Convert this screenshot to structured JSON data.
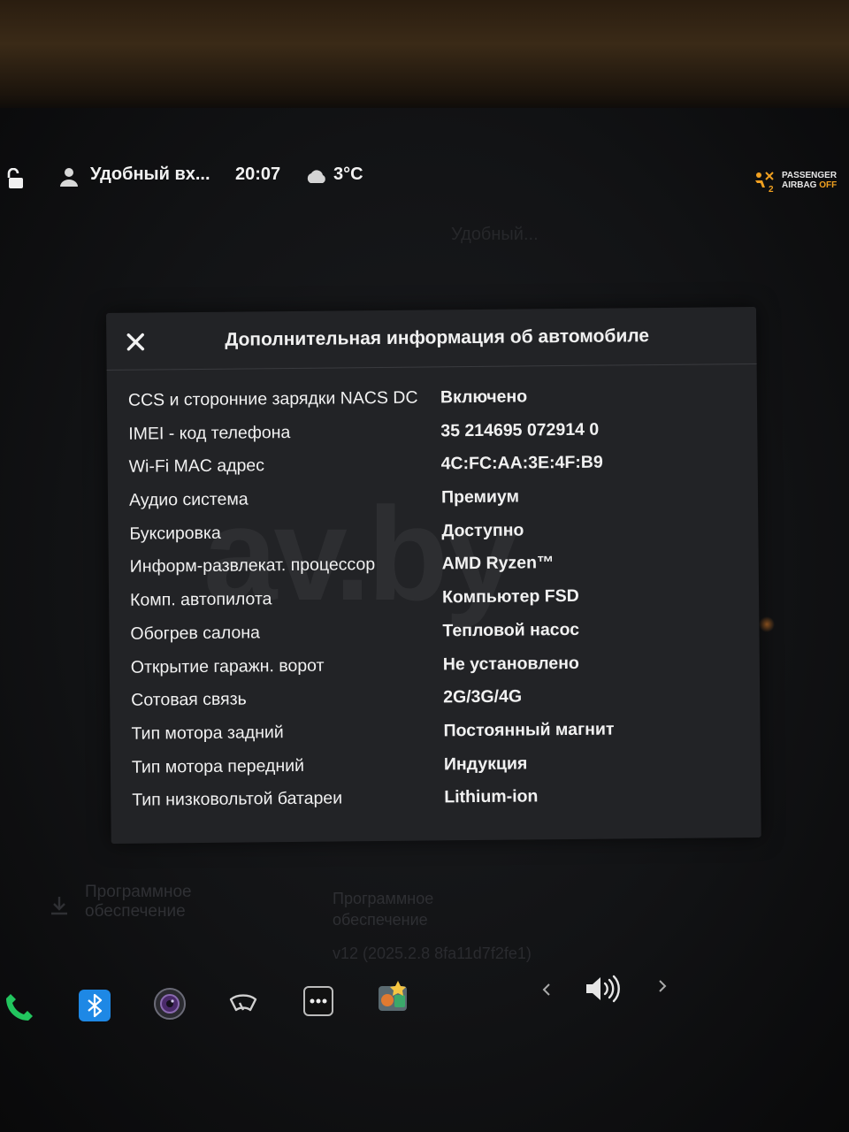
{
  "status_bar": {
    "profile_name": "Удобный вх...",
    "time": "20:07",
    "weather_icon": "cloud-icon",
    "temperature": "3°C",
    "airbag_line1": "PASSENGER",
    "airbag_line2_a": "AIRBAG",
    "airbag_line2_b": "OFF"
  },
  "background": {
    "profile_name_faded": "Удобный...",
    "software_label": [
      "Программное",
      "обеспечение"
    ],
    "software_section": [
      "Программное",
      "обеспечение"
    ],
    "version": "v12 (2025.2.8 8fa11d7f2fe1)"
  },
  "dialog": {
    "title": "Дополнительная информация об автомобиле",
    "rows": [
      {
        "label": "CCS и сторонние зарядки NACS DC",
        "value": "Включено"
      },
      {
        "label": "IMEI - код телефона",
        "value": "35 214695 072914 0"
      },
      {
        "label": "Wi-Fi MAC адрес",
        "value": "4C:FC:AA:3E:4F:B9"
      },
      {
        "label": "Аудио система",
        "value": "Премиум"
      },
      {
        "label": "Буксировка",
        "value": "Доступно"
      },
      {
        "label": "Информ-развлекат. процессор",
        "value": "AMD Ryzen™"
      },
      {
        "label": "Комп. автопилота",
        "value": "Компьютер FSD"
      },
      {
        "label": "Обогрев салона",
        "value": "Тепловой насос"
      },
      {
        "label": "Открытие гаражн. ворот",
        "value": "Не установлено"
      },
      {
        "label": "Сотовая связь",
        "value": "2G/3G/4G"
      },
      {
        "label": "Тип мотора задний",
        "value": "Постоянный магнит"
      },
      {
        "label": "Тип мотора передний",
        "value": "Индукция"
      },
      {
        "label": "Тип низковольтой батареи",
        "value": "Lithium-ion"
      }
    ]
  },
  "watermark": "av.by",
  "dock": {
    "icons": [
      "phone-icon",
      "bluetooth-icon",
      "camera-icon",
      "wiper-icon",
      "more-icon",
      "apps-icon",
      "chevron-left-icon",
      "volume-icon",
      "chevron-right-icon"
    ]
  },
  "colors": {
    "dialog_bg": "#222326",
    "phone": "#22c55e",
    "bluetooth": "#1e88e5",
    "airbag_off": "#f0a020"
  }
}
